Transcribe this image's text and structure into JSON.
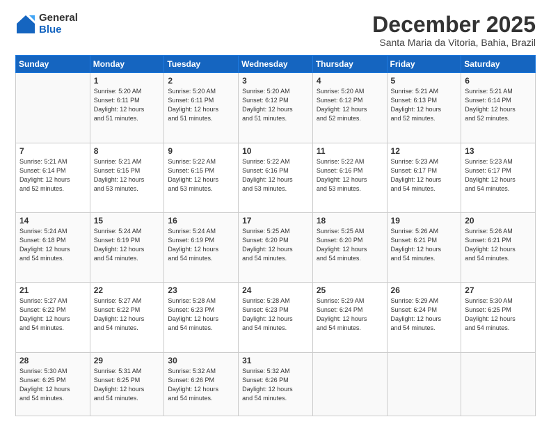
{
  "logo": {
    "general": "General",
    "blue": "Blue"
  },
  "title": "December 2025",
  "subtitle": "Santa Maria da Vitoria, Bahia, Brazil",
  "headers": [
    "Sunday",
    "Monday",
    "Tuesday",
    "Wednesday",
    "Thursday",
    "Friday",
    "Saturday"
  ],
  "weeks": [
    [
      {
        "day": "",
        "info": ""
      },
      {
        "day": "1",
        "info": "Sunrise: 5:20 AM\nSunset: 6:11 PM\nDaylight: 12 hours\nand 51 minutes."
      },
      {
        "day": "2",
        "info": "Sunrise: 5:20 AM\nSunset: 6:11 PM\nDaylight: 12 hours\nand 51 minutes."
      },
      {
        "day": "3",
        "info": "Sunrise: 5:20 AM\nSunset: 6:12 PM\nDaylight: 12 hours\nand 51 minutes."
      },
      {
        "day": "4",
        "info": "Sunrise: 5:20 AM\nSunset: 6:12 PM\nDaylight: 12 hours\nand 52 minutes."
      },
      {
        "day": "5",
        "info": "Sunrise: 5:21 AM\nSunset: 6:13 PM\nDaylight: 12 hours\nand 52 minutes."
      },
      {
        "day": "6",
        "info": "Sunrise: 5:21 AM\nSunset: 6:14 PM\nDaylight: 12 hours\nand 52 minutes."
      }
    ],
    [
      {
        "day": "7",
        "info": "Sunrise: 5:21 AM\nSunset: 6:14 PM\nDaylight: 12 hours\nand 52 minutes."
      },
      {
        "day": "8",
        "info": "Sunrise: 5:21 AM\nSunset: 6:15 PM\nDaylight: 12 hours\nand 53 minutes."
      },
      {
        "day": "9",
        "info": "Sunrise: 5:22 AM\nSunset: 6:15 PM\nDaylight: 12 hours\nand 53 minutes."
      },
      {
        "day": "10",
        "info": "Sunrise: 5:22 AM\nSunset: 6:16 PM\nDaylight: 12 hours\nand 53 minutes."
      },
      {
        "day": "11",
        "info": "Sunrise: 5:22 AM\nSunset: 6:16 PM\nDaylight: 12 hours\nand 53 minutes."
      },
      {
        "day": "12",
        "info": "Sunrise: 5:23 AM\nSunset: 6:17 PM\nDaylight: 12 hours\nand 54 minutes."
      },
      {
        "day": "13",
        "info": "Sunrise: 5:23 AM\nSunset: 6:17 PM\nDaylight: 12 hours\nand 54 minutes."
      }
    ],
    [
      {
        "day": "14",
        "info": "Sunrise: 5:24 AM\nSunset: 6:18 PM\nDaylight: 12 hours\nand 54 minutes."
      },
      {
        "day": "15",
        "info": "Sunrise: 5:24 AM\nSunset: 6:19 PM\nDaylight: 12 hours\nand 54 minutes."
      },
      {
        "day": "16",
        "info": "Sunrise: 5:24 AM\nSunset: 6:19 PM\nDaylight: 12 hours\nand 54 minutes."
      },
      {
        "day": "17",
        "info": "Sunrise: 5:25 AM\nSunset: 6:20 PM\nDaylight: 12 hours\nand 54 minutes."
      },
      {
        "day": "18",
        "info": "Sunrise: 5:25 AM\nSunset: 6:20 PM\nDaylight: 12 hours\nand 54 minutes."
      },
      {
        "day": "19",
        "info": "Sunrise: 5:26 AM\nSunset: 6:21 PM\nDaylight: 12 hours\nand 54 minutes."
      },
      {
        "day": "20",
        "info": "Sunrise: 5:26 AM\nSunset: 6:21 PM\nDaylight: 12 hours\nand 54 minutes."
      }
    ],
    [
      {
        "day": "21",
        "info": "Sunrise: 5:27 AM\nSunset: 6:22 PM\nDaylight: 12 hours\nand 54 minutes."
      },
      {
        "day": "22",
        "info": "Sunrise: 5:27 AM\nSunset: 6:22 PM\nDaylight: 12 hours\nand 54 minutes."
      },
      {
        "day": "23",
        "info": "Sunrise: 5:28 AM\nSunset: 6:23 PM\nDaylight: 12 hours\nand 54 minutes."
      },
      {
        "day": "24",
        "info": "Sunrise: 5:28 AM\nSunset: 6:23 PM\nDaylight: 12 hours\nand 54 minutes."
      },
      {
        "day": "25",
        "info": "Sunrise: 5:29 AM\nSunset: 6:24 PM\nDaylight: 12 hours\nand 54 minutes."
      },
      {
        "day": "26",
        "info": "Sunrise: 5:29 AM\nSunset: 6:24 PM\nDaylight: 12 hours\nand 54 minutes."
      },
      {
        "day": "27",
        "info": "Sunrise: 5:30 AM\nSunset: 6:25 PM\nDaylight: 12 hours\nand 54 minutes."
      }
    ],
    [
      {
        "day": "28",
        "info": "Sunrise: 5:30 AM\nSunset: 6:25 PM\nDaylight: 12 hours\nand 54 minutes."
      },
      {
        "day": "29",
        "info": "Sunrise: 5:31 AM\nSunset: 6:25 PM\nDaylight: 12 hours\nand 54 minutes."
      },
      {
        "day": "30",
        "info": "Sunrise: 5:32 AM\nSunset: 6:26 PM\nDaylight: 12 hours\nand 54 minutes."
      },
      {
        "day": "31",
        "info": "Sunrise: 5:32 AM\nSunset: 6:26 PM\nDaylight: 12 hours\nand 54 minutes."
      },
      {
        "day": "",
        "info": ""
      },
      {
        "day": "",
        "info": ""
      },
      {
        "day": "",
        "info": ""
      }
    ]
  ]
}
